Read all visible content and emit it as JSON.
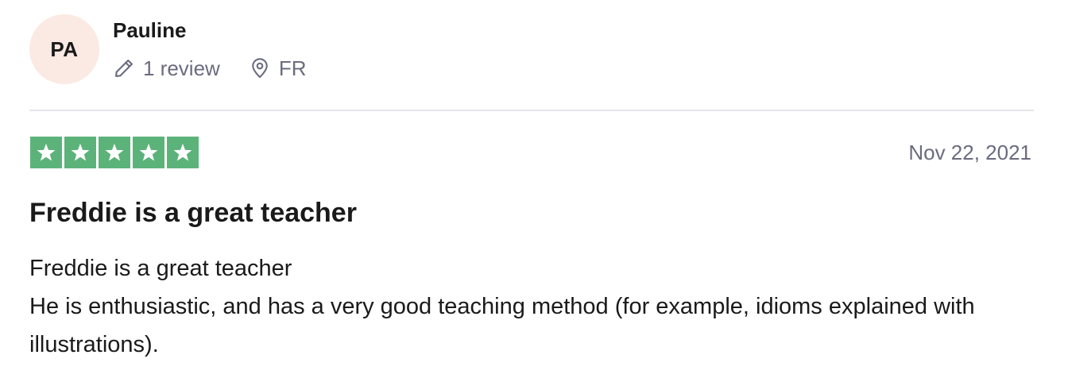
{
  "reviewer": {
    "initials": "PA",
    "name": "Pauline",
    "review_count": "1 review",
    "country": "FR"
  },
  "review": {
    "rating": 5,
    "date": "Nov 22, 2021",
    "title": "Freddie is a great teacher",
    "body_lines": [
      "Freddie is a great teacher",
      "He is enthusiastic, and has a very good teaching method (for example, idioms explained with illustrations)."
    ]
  },
  "colors": {
    "star_green": "#5cb37a",
    "avatar_bg": "#fbe9e3",
    "muted_text": "#6b6b80"
  },
  "icons": {
    "review_count": "pencil-icon",
    "location": "location-pin-icon",
    "star": "star-icon"
  }
}
